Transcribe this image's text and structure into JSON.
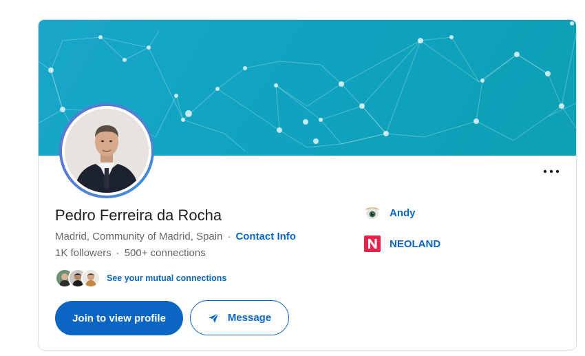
{
  "profile": {
    "name": "Pedro Ferreira da Rocha",
    "location": "Madrid, Community of Madrid, Spain",
    "separator": "·",
    "contact_info_label": "Contact Info",
    "followers": "1K followers",
    "connections": "500+ connections",
    "mutual_connections_label": "See your mutual connections"
  },
  "actions": {
    "join_label": "Join to view profile",
    "message_label": "Message",
    "more_icon": "more-horizontal-icon"
  },
  "organizations": [
    {
      "name": "Andy",
      "logo_icon": "andy-logo"
    },
    {
      "name": "NEOLAND",
      "logo_icon": "neoland-logo",
      "logo_letter": "N",
      "logo_color": "#e8234a"
    }
  ],
  "colors": {
    "accent": "#0a66c2",
    "banner": "#10a3c0",
    "text_primary": "#1d1d1d",
    "text_secondary": "#666666"
  }
}
